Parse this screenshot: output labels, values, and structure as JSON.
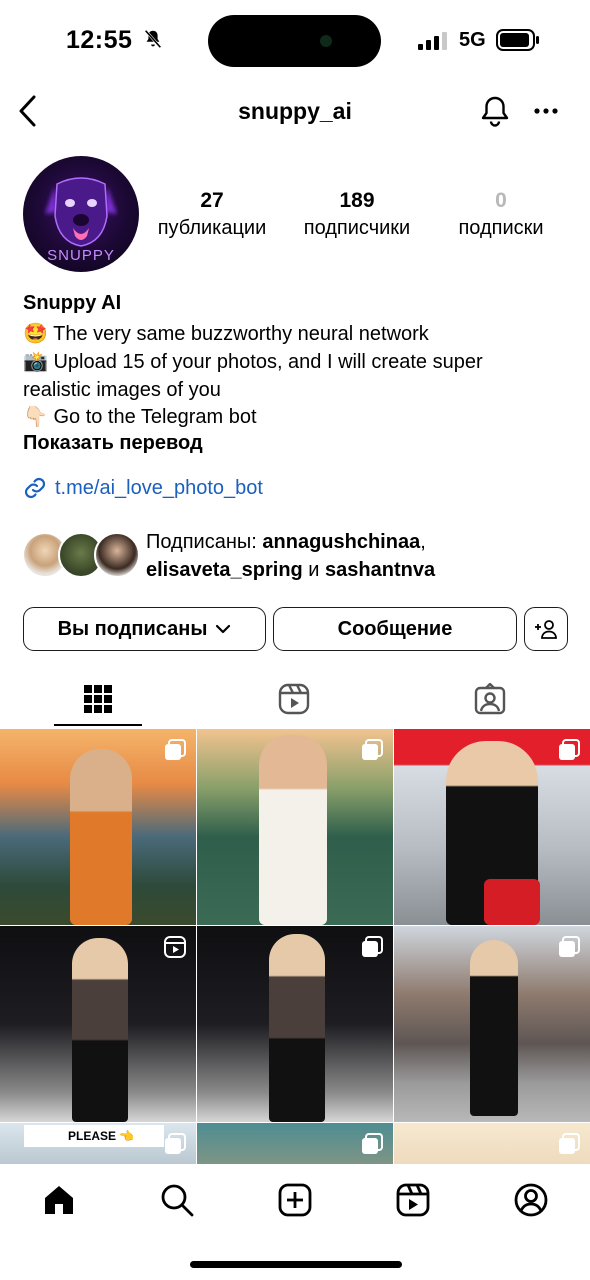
{
  "status_bar": {
    "time": "12:55",
    "network": "5G"
  },
  "header": {
    "username": "snuppy_ai"
  },
  "profile": {
    "avatar_label": "SNUPPY",
    "stats": [
      {
        "value": "27",
        "label": "публикации"
      },
      {
        "value": "189",
        "label": "подписчики"
      },
      {
        "value": "0",
        "label": "подписки"
      }
    ],
    "display_name": "Snuppy AI",
    "bio": [
      "🤩 The very same buzzworthy neural network",
      "📸 Upload 15 of your photos, and I will create super",
      "realistic images of you",
      "👇🏻 Go to the Telegram bot"
    ],
    "show_translation": "Показать перевод",
    "link": "t.me/ai_love_photo_bot",
    "followed_by": {
      "prefix": "Подписаны: ",
      "user1": "annagushchinaa",
      "comma": ",",
      "user2": "elisaveta_spring",
      "and": " и ",
      "user3": "sashantnva"
    }
  },
  "actions": {
    "following": "Вы подписаны",
    "message": "Сообщение"
  },
  "grid": {
    "overlay_text": "PLEASE 👈"
  },
  "colors": {
    "link": "#1b5fbf",
    "muted": "#b8b8b8",
    "avatar_bg": "#1b0833"
  }
}
